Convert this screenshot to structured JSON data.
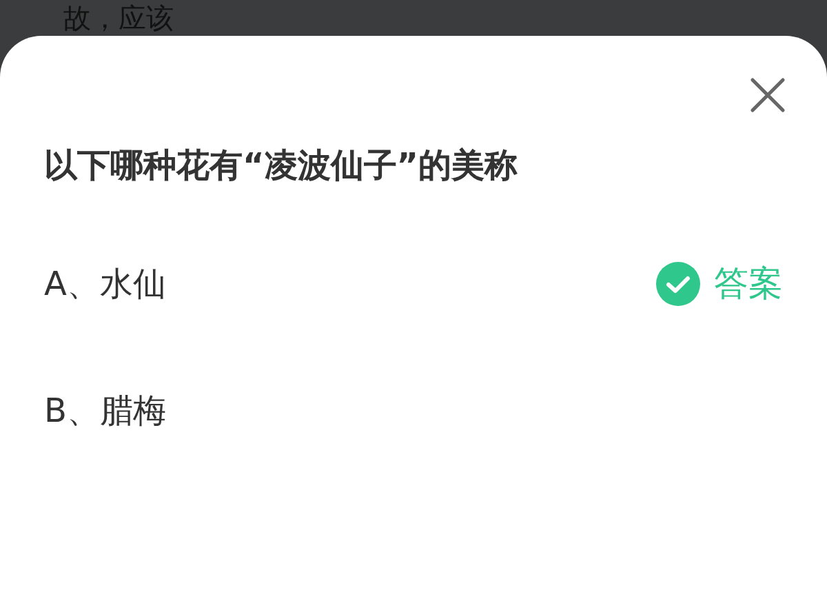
{
  "background_text": "故，应该",
  "question": "以下哪种花有“凌波仙子”的美称",
  "options": [
    {
      "label": "A、水仙",
      "correct": true,
      "answer_label": "答案"
    },
    {
      "label": "B、腊梅",
      "correct": false
    }
  ]
}
